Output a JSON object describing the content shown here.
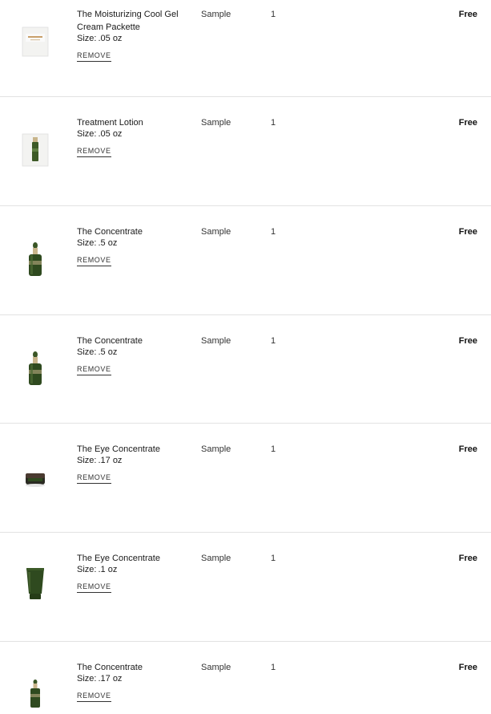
{
  "cart": {
    "size_prefix": "Size:",
    "items": [
      {
        "name": "The Moisturizing Cool Gel Cream Packette",
        "size": ".05 oz",
        "type": "Sample",
        "qty": "1",
        "price": "Free",
        "remove": "REMOVE",
        "image": "sachet-cream-icon"
      },
      {
        "name": "Treatment Lotion",
        "size": ".05 oz",
        "type": "Sample",
        "qty": "1",
        "price": "Free",
        "remove": "REMOVE",
        "image": "sachet-lotion-icon"
      },
      {
        "name": "The Concentrate",
        "size": ".5 oz",
        "type": "Sample",
        "qty": "1",
        "price": "Free",
        "remove": "REMOVE",
        "image": "dropper-bottle-icon"
      },
      {
        "name": "The Concentrate",
        "size": ".5 oz",
        "type": "Sample",
        "qty": "1",
        "price": "Free",
        "remove": "REMOVE",
        "image": "dropper-bottle-icon"
      },
      {
        "name": "The Eye Concentrate",
        "size": ".17 oz",
        "type": "Sample",
        "qty": "1",
        "price": "Free",
        "remove": "REMOVE",
        "image": "eye-jar-icon"
      },
      {
        "name": "The Eye Concentrate",
        "size": ".1 oz",
        "type": "Sample",
        "qty": "1",
        "price": "Free",
        "remove": "REMOVE",
        "image": "tube-icon"
      },
      {
        "name": "The Concentrate",
        "size": ".17 oz",
        "type": "Sample",
        "qty": "1",
        "price": "Free",
        "remove": "REMOVE",
        "image": "small-bottle-icon"
      }
    ]
  },
  "colors": {
    "bottle_green": "#2f4a1f",
    "bottle_green_light": "#4d6b34",
    "cap_gold": "#c8b48a",
    "divider": "#e2e2e2"
  }
}
